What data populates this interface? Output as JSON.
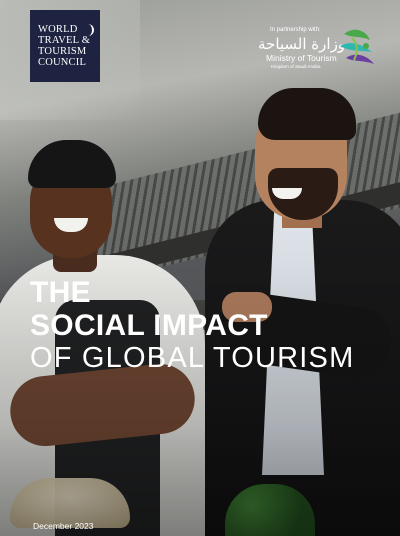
{
  "logo": {
    "lines": [
      "WORLD",
      "TRAVEL &",
      "TOURISM",
      "COUNCIL"
    ]
  },
  "partnership": {
    "label": "In partnership with:",
    "arabic": "وزارة السياحة",
    "ministry": "Ministry of Tourism",
    "kingdom": "Kingdom of Saudi Arabia",
    "icon": "saudi-tourism-emblem-icon"
  },
  "title": {
    "line1": "THE",
    "line2": "SOCIAL IMPACT",
    "line3": "OF GLOBAL TOURISM"
  },
  "date": "December 2023",
  "colors": {
    "logo_bg": "#1d2340",
    "title_text": "#ffffff",
    "emblem_green": "#49a84a",
    "emblem_purple": "#6b3fa0",
    "emblem_teal": "#2fb7b0"
  }
}
